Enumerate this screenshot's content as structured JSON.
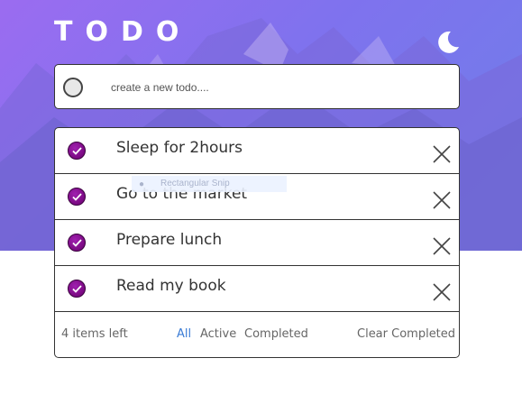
{
  "header": {
    "title": "TODO",
    "theme_icon": "moon-icon"
  },
  "create": {
    "placeholder": "create a new todo....",
    "value": ""
  },
  "todos": [
    {
      "text": "Sleep for 2hours",
      "completed": true
    },
    {
      "text": "Go to the market",
      "completed": true
    },
    {
      "text": "Prepare lunch",
      "completed": true
    },
    {
      "text": "Read my book",
      "completed": true
    }
  ],
  "footer": {
    "items_left": "4 items left",
    "filter_all": "All",
    "filter_active": "Active",
    "filter_completed": "Completed",
    "clear_completed": "Clear Completed"
  },
  "overlay": {
    "snip_label": "Rectangular Snip",
    "snip_icon": "bullet-icon"
  },
  "colors": {
    "accent": "#3a7bd5",
    "check": "#8a1a94",
    "hero_start": "#9b6cf0",
    "hero_end": "#6e7fe8"
  }
}
